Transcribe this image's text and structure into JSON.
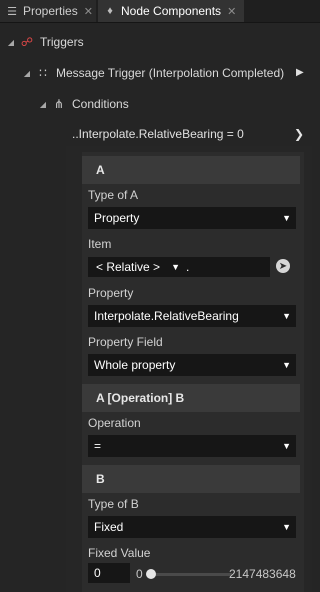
{
  "tabs": [
    {
      "label": "Properties",
      "icon": "list-icon"
    },
    {
      "label": "Node Components",
      "icon": "components-icon"
    }
  ],
  "tree": {
    "triggers": {
      "label": "Triggers",
      "icon": "trigger-icon"
    },
    "message_trigger": {
      "label": "Message Trigger (Interpolation Completed)",
      "icon": "message-trigger-icon"
    },
    "conditions": {
      "label": "Conditions",
      "icon": "conditions-icon"
    }
  },
  "condition": {
    "summary": "..Interpolate.RelativeBearing = 0",
    "section_a": {
      "title": "A",
      "type_label": "Type of A",
      "type_value": "Property",
      "item_label": "Item",
      "item_value": "< Relative >",
      "item_path": ".",
      "property_label": "Property",
      "property_value": "Interpolate.RelativeBearing",
      "field_label": "Property Field",
      "field_value": "Whole property"
    },
    "section_op": {
      "title": "A [Operation] B",
      "operation_label": "Operation",
      "operation_value": "="
    },
    "section_b": {
      "title": "B",
      "type_label": "Type of B",
      "type_value": "Fixed",
      "fixed_label": "Fixed Value",
      "fixed_value": "0",
      "slider_min": "0",
      "slider_max": "2147483648",
      "slider_fraction": 0
    }
  }
}
